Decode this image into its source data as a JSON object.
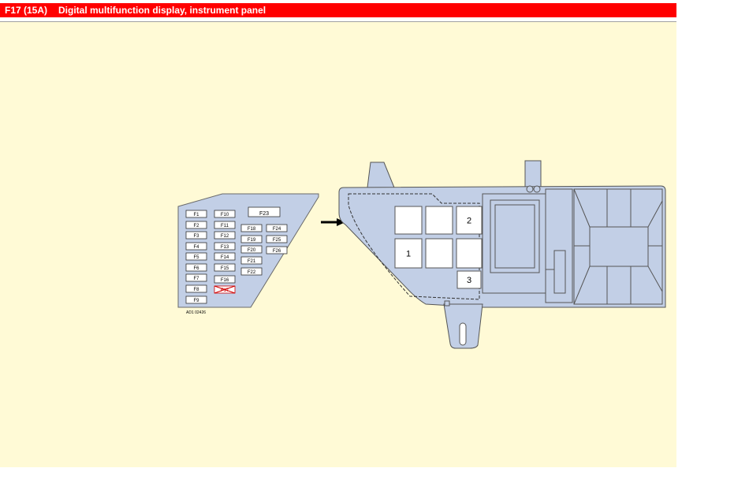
{
  "header": {
    "code": "F17 (15A)",
    "description": "Digital multifunction display, instrument panel"
  },
  "diagram": {
    "reference_code": "AD1 02426",
    "fuse_panel": {
      "fuses": [
        "F1",
        "F2",
        "F3",
        "F4",
        "F5",
        "F6",
        "F7",
        "F8",
        "F9",
        "F10",
        "F11",
        "F12",
        "F13",
        "F14",
        "F15",
        "F16",
        "F17",
        "F18",
        "F19",
        "F20",
        "F21",
        "F22",
        "F23",
        "F24",
        "F25",
        "F26"
      ],
      "highlighted": "F17"
    },
    "relay_box": {
      "relays": [
        "1",
        "2",
        "3"
      ]
    },
    "colors": {
      "header_bg": "#ff0000",
      "background": "#fffad6",
      "panel_fill": "#c2cfe6",
      "relay_fill": "#ffffff",
      "highlight": "#d00000"
    }
  }
}
